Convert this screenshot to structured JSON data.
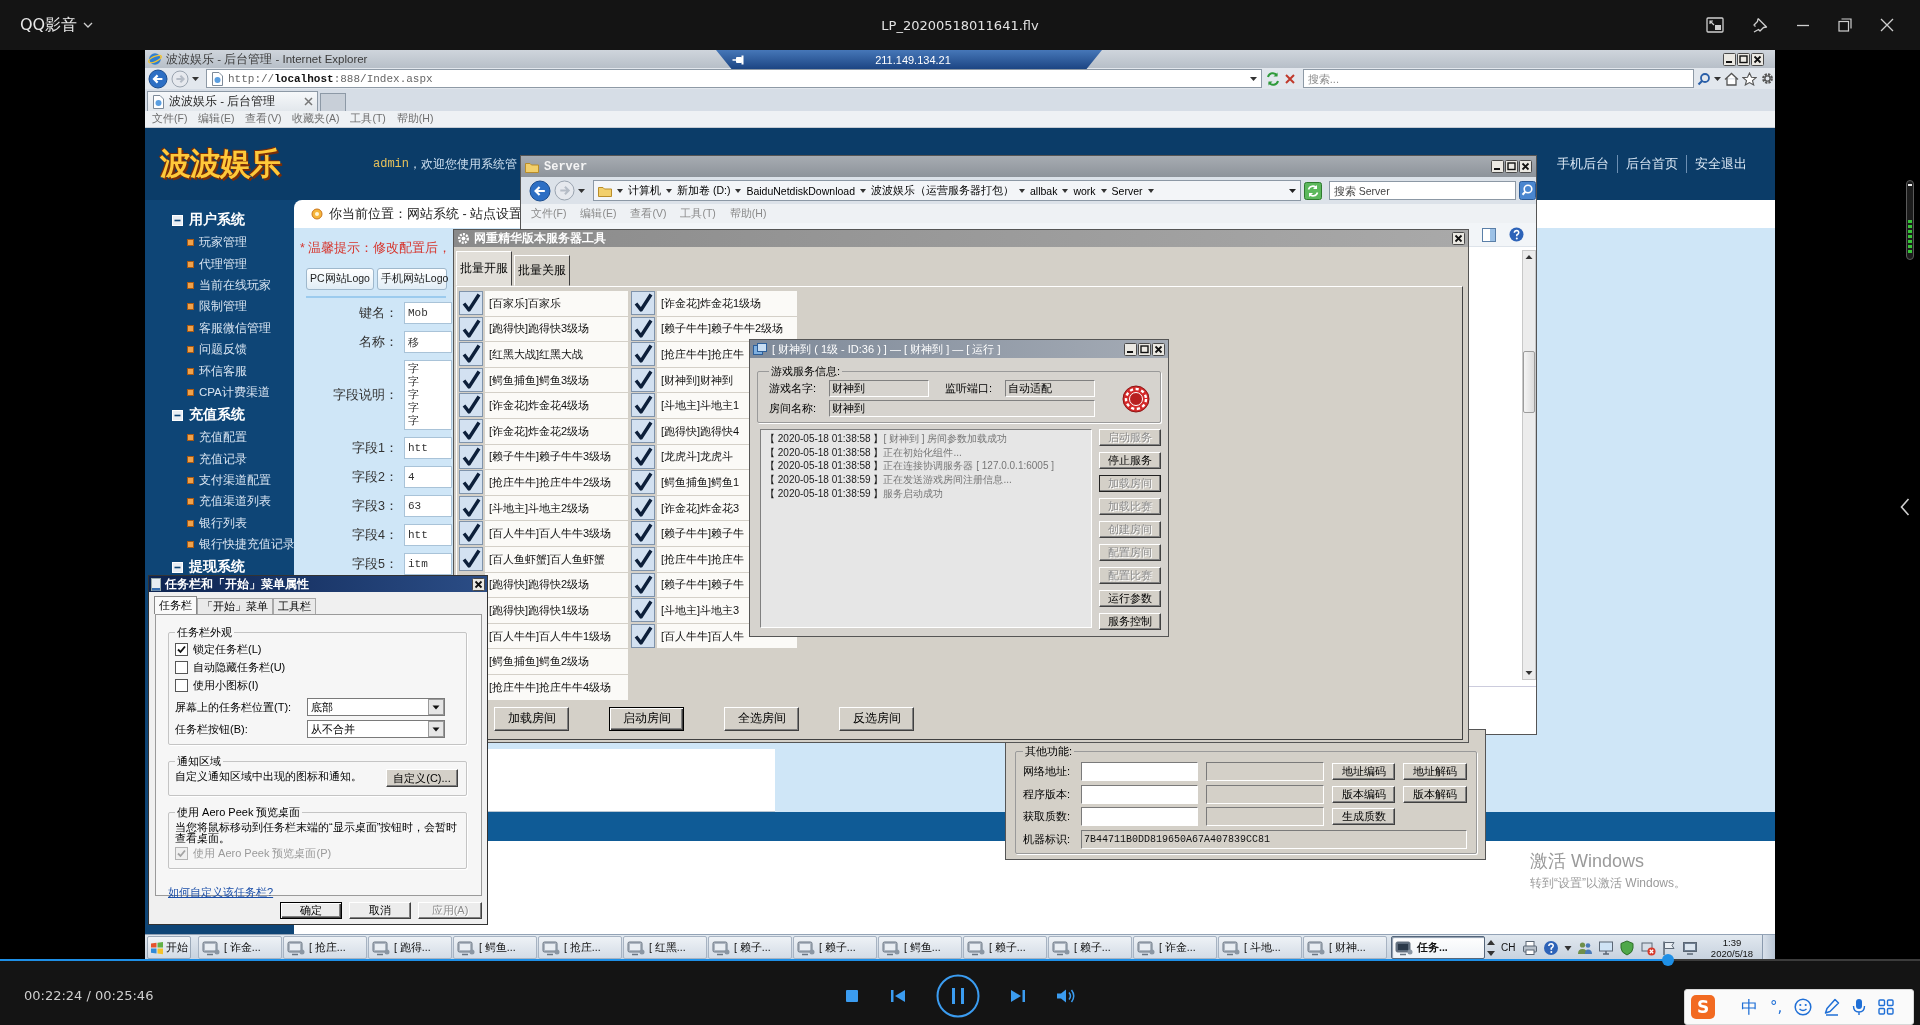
{
  "player": {
    "app_name": "QQ影音",
    "file_name": "LP_20200518011641.flv",
    "time": "00:22:24 / 00:25:46",
    "progress": {
      "level": 0.869
    }
  },
  "remote_bar": {
    "host": "211.149.134.21"
  },
  "browser": {
    "title": "波波娱乐 - 后台管理 - Internet Explorer",
    "url": "http://**localhost**:888/Index.aspx",
    "search_placeholder": "搜索...",
    "tab": "波波娱乐 - 后台管理",
    "menu": [
      "文件(F)",
      "编辑(E)",
      "查看(V)",
      "收藏夹(A)",
      "工具(T)",
      "帮助(H)"
    ]
  },
  "site": {
    "logo": "波波娱乐",
    "user": "admin",
    "welcome": "，欢迎您使用系统管",
    "links": [
      "手机后台",
      "后台首页",
      "安全退出"
    ],
    "sidebar": [
      {
        "title": "用户系统",
        "items": [
          "玩家管理",
          "代理管理",
          "当前在线玩家",
          "限制管理",
          "客服微信管理",
          "问题反馈",
          "环信客服",
          "CPA计费渠道"
        ]
      },
      {
        "title": "充值系统",
        "items": [
          "充值配置",
          "充值记录",
          "支付渠道配置",
          "充值渠道列表",
          "银行列表",
          "银行快捷充值记录"
        ]
      },
      {
        "title": "提现系统"
      }
    ],
    "breadcrumb": "你当前位置：网站系统 - 站点设置",
    "notice": "* 温馨提示：修改配置后，",
    "logo_tabs": [
      "PC网站Logo",
      "手机网站Logo"
    ],
    "fields": [
      {
        "kind": "input",
        "label": "键名：",
        "value": "Mob"
      },
      {
        "kind": "input",
        "label": "名称：",
        "value": "移"
      },
      {
        "kind": "textarea",
        "label": "字段说明：",
        "lines": [
          "字",
          "字",
          "字",
          "字",
          "字"
        ]
      },
      {
        "kind": "input",
        "label": "字段1：",
        "value": "htt"
      },
      {
        "kind": "input",
        "label": "字段2：",
        "value": "4"
      },
      {
        "kind": "input",
        "label": "字段3：",
        "value": "63"
      },
      {
        "kind": "input",
        "label": "字段4：",
        "value": "htt"
      },
      {
        "kind": "input",
        "label": "字段5：",
        "value": "itm"
      }
    ]
  },
  "explorer": {
    "title": "Server",
    "path": [
      "计算机",
      "新加卷 (D:)",
      "BaiduNetdiskDownload",
      "波波娱乐（运营服务器打包）",
      "allbak",
      "work",
      "Server"
    ],
    "search_placeholder": "搜索 Server",
    "menu": [
      "文件(F)",
      "编辑(E)",
      "查看(V)",
      "工具(T)",
      "帮助(H)"
    ]
  },
  "server_tool": {
    "title": "网重精华版本服务器工具",
    "tabs": [
      {
        "label": "批量开服",
        "selected": true
      },
      {
        "label": "批量关服",
        "selected": false
      }
    ],
    "room_columns": [
      {
        "rooms": [
          {
            "kind": "check",
            "label": "[百家乐]百家乐",
            "checked": true
          },
          {
            "kind": "check",
            "label": "[跑得快]跑得快3级场",
            "checked": true
          },
          {
            "kind": "check",
            "label": "[红黑大战]红黑大战",
            "checked": true
          },
          {
            "kind": "check",
            "label": "[鳄鱼捕鱼]鳄鱼3级场",
            "checked": true
          },
          {
            "kind": "check",
            "label": "[诈金花]炸金花4级场",
            "checked": true
          },
          {
            "kind": "check",
            "label": "[诈金花]炸金花2级场",
            "checked": true
          },
          {
            "kind": "check",
            "label": "[赖子牛牛]赖子牛牛3级场",
            "checked": true
          },
          {
            "kind": "check",
            "label": "[抢庄牛牛]抢庄牛牛2级场",
            "checked": true
          },
          {
            "kind": "check",
            "label": "[斗地主]斗地主2级场",
            "checked": true
          },
          {
            "kind": "check",
            "label": "[百人牛牛]百人牛牛3级场",
            "checked": true
          },
          {
            "kind": "check",
            "label": "[百人鱼虾蟹]百人鱼虾蟹",
            "checked": true
          },
          {
            "kind": "plain",
            "label": "[跑得快]跑得快2级场"
          },
          {
            "kind": "plain",
            "label": "[跑得快]跑得快1级场"
          },
          {
            "kind": "plain",
            "label": "[百人牛牛]百人牛牛1级场"
          },
          {
            "kind": "plain",
            "label": "[鳄鱼捕鱼]鳄鱼2级场"
          },
          {
            "kind": "plain",
            "label": "[抢庄牛牛]抢庄牛牛4级场"
          }
        ]
      },
      {
        "rooms": [
          {
            "kind": "check",
            "label": "[诈金花]炸金花1级场",
            "checked": true
          },
          {
            "kind": "check",
            "label": "[赖子牛牛]赖子牛牛2级场",
            "checked": true
          },
          {
            "kind": "check",
            "label": "[抢庄牛牛]抢庄牛",
            "checked": true
          },
          {
            "kind": "check",
            "label": "[财神到]财神到",
            "checked": true
          },
          {
            "kind": "check",
            "label": "[斗地主]斗地主1",
            "checked": true
          },
          {
            "kind": "check",
            "label": "[跑得快]跑得快4",
            "checked": true
          },
          {
            "kind": "check",
            "label": "[龙虎斗]龙虎斗",
            "checked": true
          },
          {
            "kind": "check",
            "label": "[鳄鱼捕鱼]鳄鱼1",
            "checked": true
          },
          {
            "kind": "check",
            "label": "[诈金花]炸金花3",
            "checked": true
          },
          {
            "kind": "check",
            "label": "[赖子牛牛]赖子牛",
            "checked": true
          },
          {
            "kind": "check",
            "label": "[抢庄牛牛]抢庄牛",
            "checked": true
          },
          {
            "kind": "check",
            "label": "[赖子牛牛]赖子牛",
            "checked": true
          },
          {
            "kind": "check",
            "label": "[斗地主]斗地主3",
            "checked": true
          },
          {
            "kind": "check",
            "label": "[百人牛牛]百人牛",
            "checked": true
          }
        ]
      }
    ],
    "buttons": [
      {
        "label": "加载房间",
        "default": false
      },
      {
        "label": "启动房间",
        "default": true
      },
      {
        "label": "全选房间",
        "default": false
      },
      {
        "label": "反选房间",
        "default": false
      }
    ]
  },
  "service_window": {
    "title": "[ 财神到 ( 1级 - ID:36 ) ] — [ 财神到 ] — [ 运行 ]",
    "group": "游戏服务信息:",
    "fields": [
      {
        "label": "游戏名字:",
        "value": "财神到"
      },
      {
        "label": "监听端口:",
        "value": "自动适配"
      },
      {
        "label": "房间名称:",
        "value": "财神到"
      }
    ],
    "log": [
      {
        "stamp": "【 2020-05-18 01:38:58 】",
        "message": "[ 财神到 ] 房间参数加载成功"
      },
      {
        "stamp": "【 2020-05-18 01:38:58 】",
        "message": "正在初始化组件..."
      },
      {
        "stamp": "【 2020-05-18 01:38:58 】",
        "message": "正在连接协调服务器 [ 127.0.0.1:6005 ]"
      },
      {
        "stamp": "【 2020-05-18 01:38:59 】",
        "message": "正在发送游戏房间注册信息..."
      },
      {
        "stamp": "【 2020-05-18 01:38:59 】",
        "message": "服务启动成功"
      }
    ],
    "buttons": [
      {
        "label": "启动服务",
        "disabled": true,
        "focused": false
      },
      {
        "label": "停止服务",
        "disabled": false,
        "focused": false
      },
      {
        "label": "加载房间",
        "disabled": true,
        "focused": true
      },
      {
        "label": "加载比赛",
        "disabled": true,
        "focused": false
      },
      {
        "label": "创建房间",
        "disabled": true,
        "focused": false
      },
      {
        "label": "配置房间",
        "disabled": true,
        "focused": false
      },
      {
        "label": "配置比赛",
        "disabled": true,
        "focused": false
      },
      {
        "label": "运行参数",
        "disabled": false,
        "focused": false
      },
      {
        "label": "服务控制",
        "disabled": false,
        "focused": false
      }
    ]
  },
  "other_tools": {
    "group": "其他功能:",
    "rows": [
      {
        "label": "网络地址:",
        "buttons": [
          "地址编码",
          "地址解码"
        ]
      },
      {
        "label": "程序版本:",
        "buttons": [
          "版本编码",
          "版本解码"
        ]
      },
      {
        "label": "获取质数:",
        "buttons": [
          "生成质数"
        ]
      }
    ],
    "machine_id": {
      "label": "机器标识:",
      "value": "7B44711B0DD819650A67A407839CC81"
    }
  },
  "taskbar_dialog": {
    "title": "任务栏和「开始」菜单属性",
    "tabs": [
      {
        "label": "任务栏",
        "selected": true
      },
      {
        "label": "「开始」菜单",
        "selected": false
      },
      {
        "label": "工具栏",
        "selected": false
      }
    ],
    "appearance": {
      "legend": "任务栏外观",
      "checks": [
        {
          "label": "锁定任务栏(L)",
          "checked": true
        },
        {
          "label": "自动隐藏任务栏(U)",
          "checked": false
        },
        {
          "label": "使用小图标(I)",
          "checked": false
        }
      ],
      "selects": [
        {
          "label": "屏幕上的任务栏位置(T):",
          "value": "底部"
        },
        {
          "label": "任务栏按钮(B):",
          "value": "从不合并"
        }
      ]
    },
    "notify": {
      "legend": "通知区域",
      "text": "自定义通知区域中出现的图标和通知。",
      "button": "自定义(C)..."
    },
    "peek": {
      "legend": "使用 Aero Peek 预览桌面",
      "text": "当您将鼠标移动到任务栏末端的“显示桌面”按钮时，会暂时查看桌面。",
      "check": {
        "label": "使用 Aero Peek 预览桌面(P)",
        "checked": true,
        "disabled": true
      }
    },
    "help_link": "如何自定义该任务栏?",
    "buttons": [
      {
        "label": "确定",
        "default": true,
        "disabled": false
      },
      {
        "label": "取消",
        "default": false,
        "disabled": false
      },
      {
        "label": "应用(A)",
        "default": false,
        "disabled": true
      }
    ]
  },
  "activation": {
    "title": "激活 Windows",
    "text": "转到“设置”以激活 Windows。"
  },
  "taskbar": {
    "start": "开始",
    "buttons": [
      {
        "label": "[ 诈金...",
        "selected": false
      },
      {
        "label": "[ 抢庄...",
        "selected": false
      },
      {
        "label": "[ 跑得...",
        "selected": false
      },
      {
        "label": "[ 鳄鱼...",
        "selected": false
      },
      {
        "label": "[ 抢庄...",
        "selected": false
      },
      {
        "label": "[ 红黑...",
        "selected": false
      },
      {
        "label": "[ 赖子...",
        "selected": false
      },
      {
        "label": "[ 赖子...",
        "selected": false
      },
      {
        "label": "[ 鳄鱼...",
        "selected": false
      },
      {
        "label": "[ 赖子...",
        "selected": false
      },
      {
        "label": "[ 赖子...",
        "selected": false
      },
      {
        "label": "[ 诈金...",
        "selected": false
      },
      {
        "label": "[ 斗地...",
        "selected": false
      },
      {
        "label": "[ 财神...",
        "selected": false
      },
      {
        "label": "任务...",
        "selected": true
      }
    ],
    "language": "CH",
    "time": "1:39",
    "date": "2020/5/18"
  },
  "ime": {
    "logo": "S",
    "mode": "中",
    "punct": "°,"
  }
}
